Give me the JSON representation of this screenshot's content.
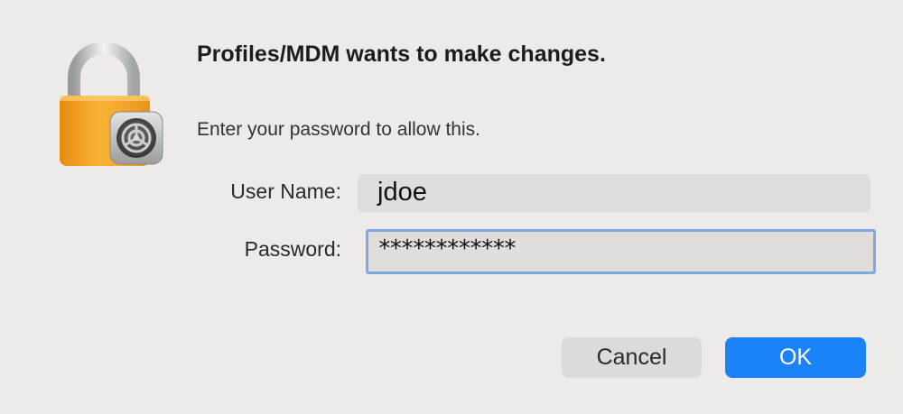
{
  "dialog": {
    "title": "Profiles/MDM wants to make changes.",
    "message": "Enter your password to allow this.",
    "icon": "lock-with-settings-gear-icon"
  },
  "form": {
    "username_label": "User Name:",
    "username_value": "jdoe",
    "password_label": "Password:",
    "password_value": "************"
  },
  "buttons": {
    "cancel_label": "Cancel",
    "ok_label": "OK"
  },
  "colors": {
    "background": "#efeaea",
    "lock_body": "#f7a82c",
    "focus_ring": "#7fa8de",
    "primary_button": "#1a83f8",
    "secondary_button": "#dedada"
  }
}
